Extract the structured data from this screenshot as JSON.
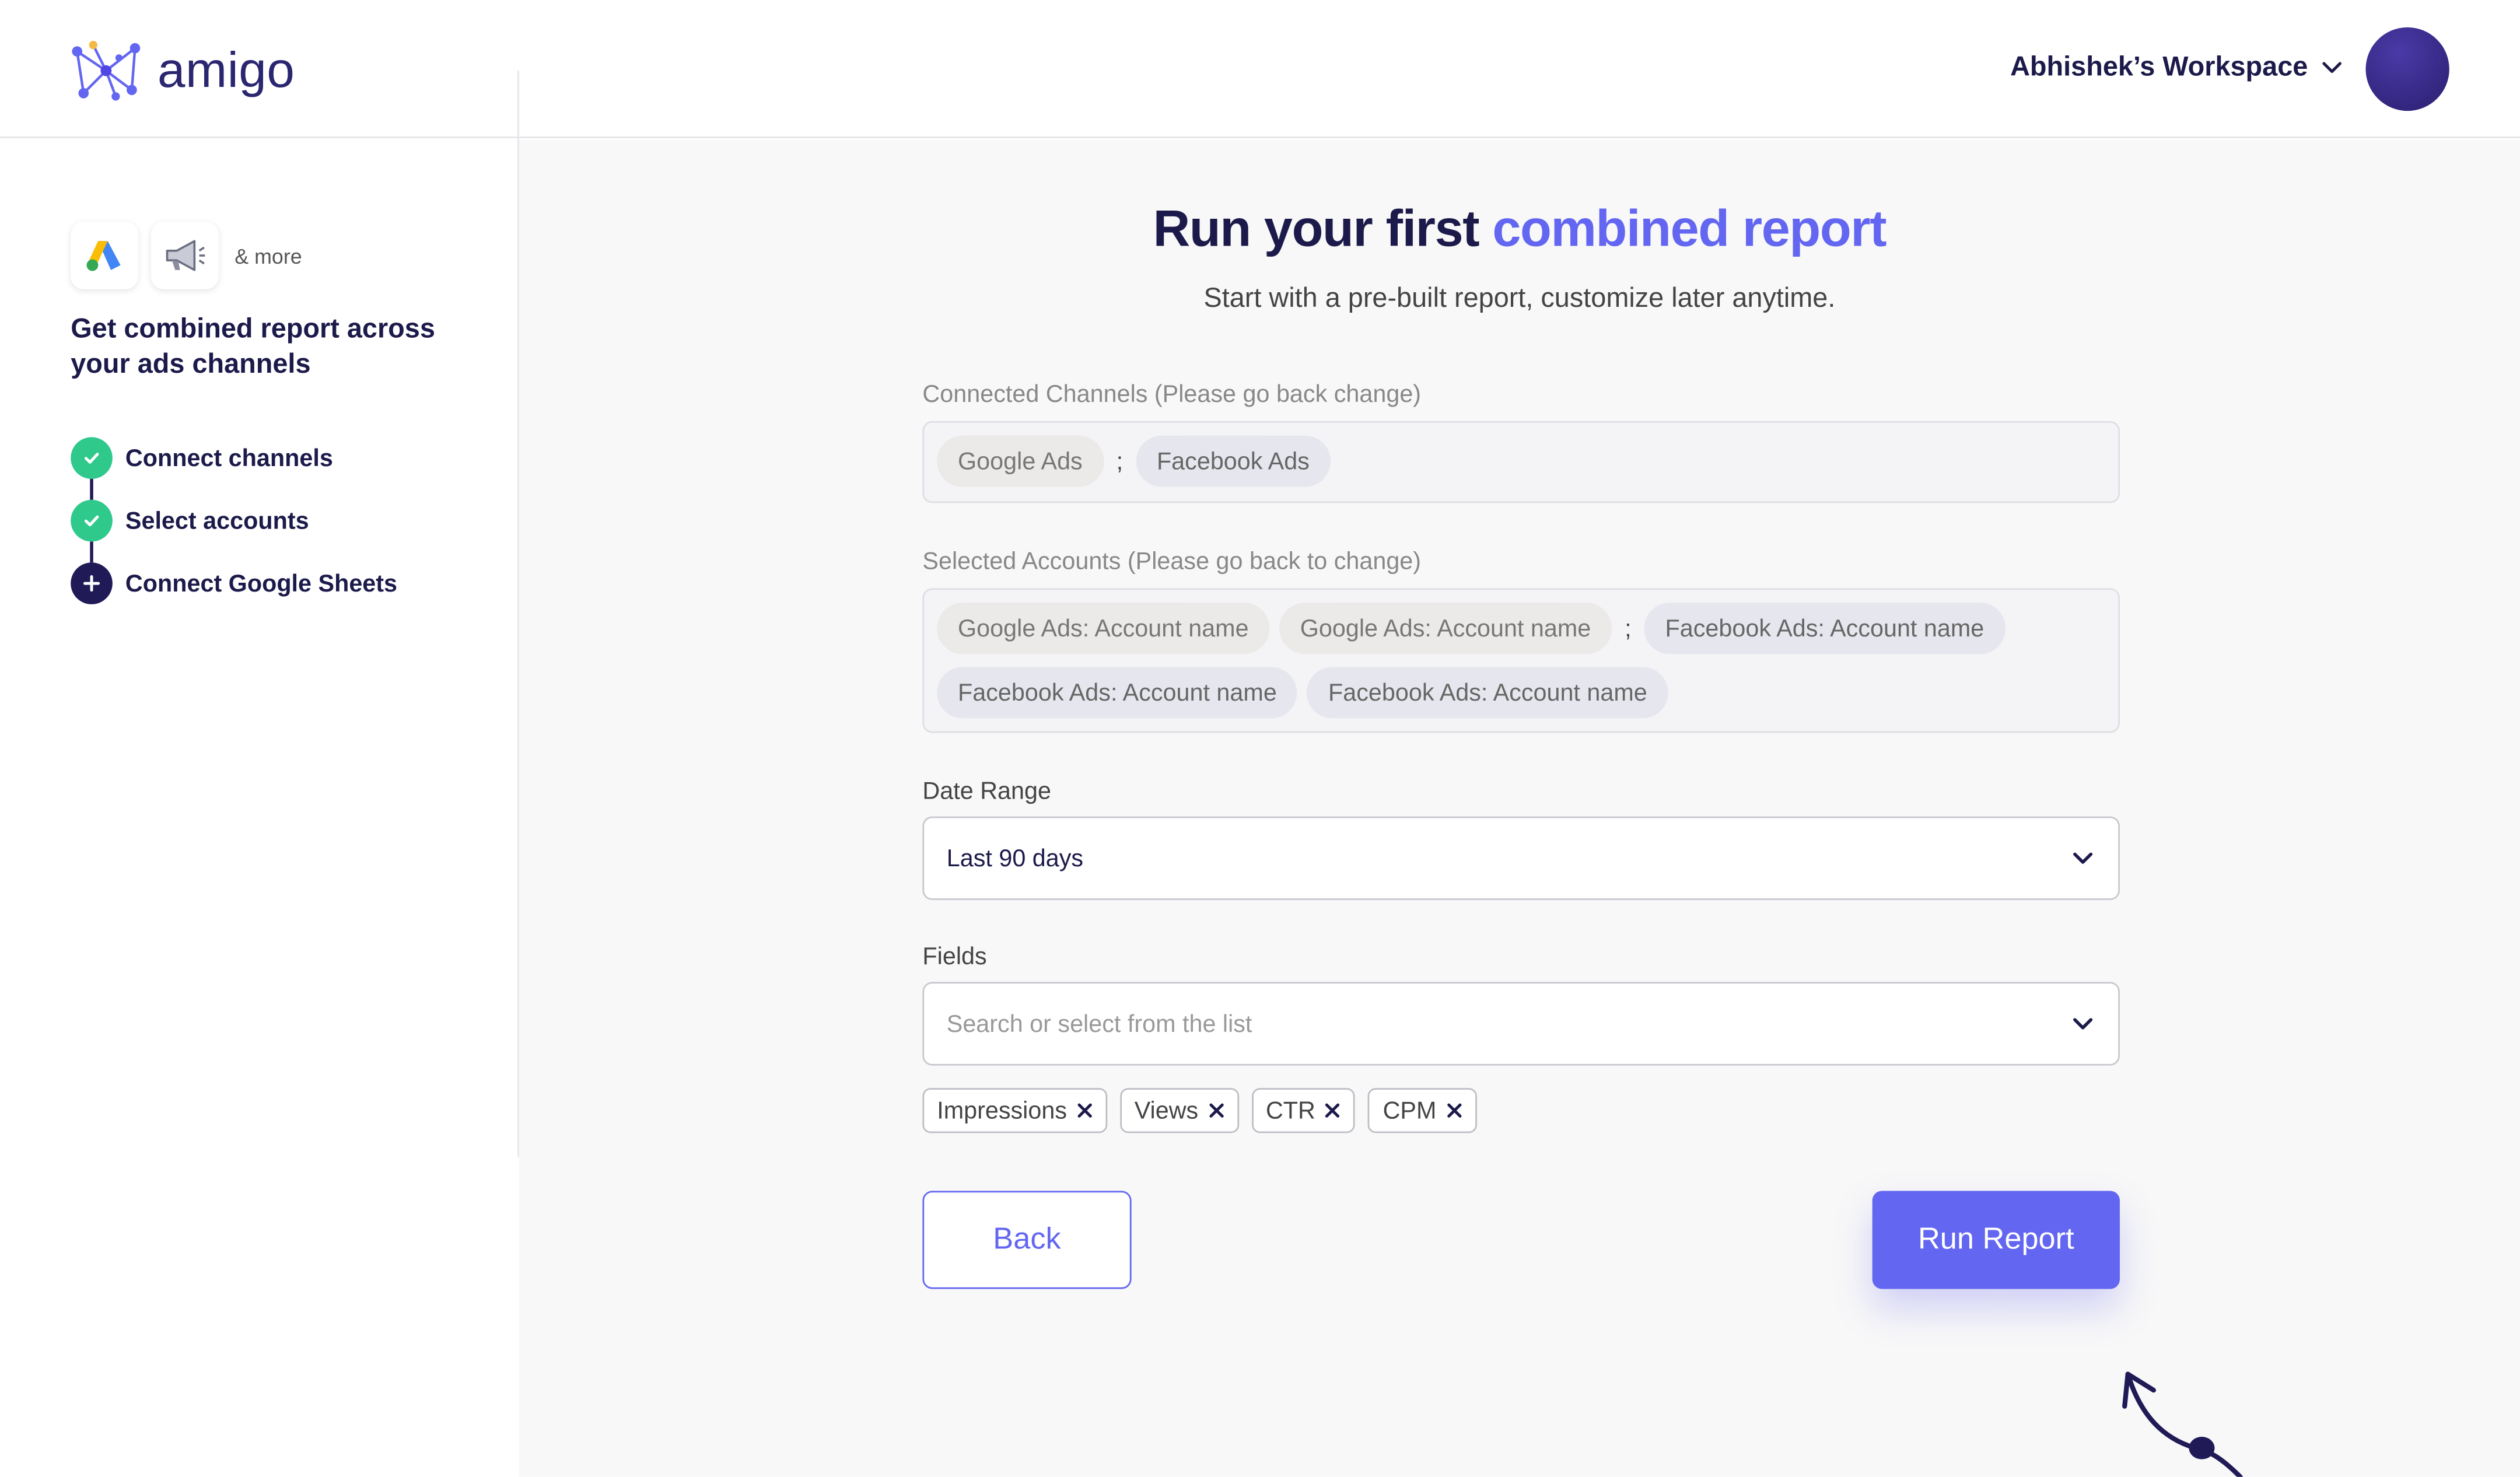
{
  "app": {
    "logo_text": "amigo",
    "workspace_label": "Abhishek’s Workspace"
  },
  "sidebar": {
    "more_label": "& more",
    "heading": "Get combined report across your ads channels",
    "steps": [
      {
        "label": "Connect channels",
        "status": "done"
      },
      {
        "label": "Select accounts",
        "status": "done"
      },
      {
        "label": "Connect Google Sheets",
        "status": "current"
      }
    ]
  },
  "main": {
    "title_prefix": "Run your first ",
    "title_accent": "combined report",
    "subtitle": "Start with a pre-built report, customize later anytime.",
    "channels": {
      "label": "Connected Channels (Please go back change)",
      "items": [
        "Google Ads",
        "Facebook Ads"
      ],
      "separator": ";"
    },
    "accounts": {
      "label": "Selected Accounts (Please go back to change)",
      "items": [
        "Google Ads: Account name",
        "Google Ads: Account name",
        "Facebook Ads: Account name",
        "Facebook Ads: Account name",
        "Facebook Ads: Account name"
      ],
      "separator": ";"
    },
    "date_range": {
      "label": "Date Range",
      "value": "Last 90 days"
    },
    "fields": {
      "label": "Fields",
      "placeholder": "Search or select from the list",
      "selected": [
        "Impressions",
        "Views",
        "CTR",
        "CPM"
      ]
    },
    "buttons": {
      "back": "Back",
      "run": "Run Report"
    }
  },
  "colors": {
    "accent": "#6366f1",
    "navy": "#1c1a4a",
    "success": "#2fc98c"
  }
}
